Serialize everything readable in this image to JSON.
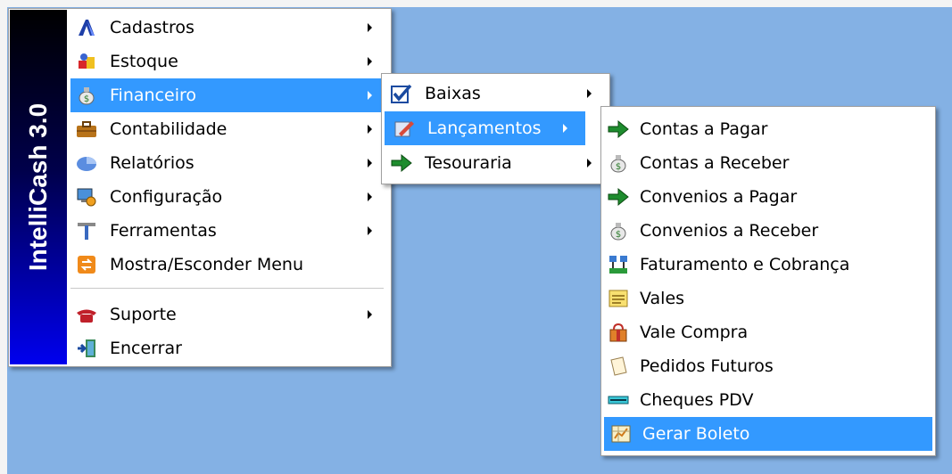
{
  "app": {
    "banner_text": "IntelliCash 3.0"
  },
  "main_menu": {
    "items": [
      {
        "label": "Cadastros",
        "icon": "cadastros-icon"
      },
      {
        "label": "Estoque",
        "icon": "estoque-icon"
      },
      {
        "label": "Financeiro",
        "icon": "money-bag-icon"
      },
      {
        "label": "Contabilidade",
        "icon": "briefcase-icon"
      },
      {
        "label": "Relatórios",
        "icon": "pie-chart-icon"
      },
      {
        "label": "Configuração",
        "icon": "configuration-icon"
      },
      {
        "label": "Ferramentas",
        "icon": "tools-icon"
      },
      {
        "label": "Mostra/Esconder Menu",
        "icon": "toggle-menu-icon"
      },
      {
        "label": "Suporte",
        "icon": "telephone-icon"
      },
      {
        "label": "Encerrar",
        "icon": "exit-door-icon"
      }
    ]
  },
  "financeiro_menu": {
    "items": [
      {
        "label": "Baixas",
        "icon": "checkbox-icon"
      },
      {
        "label": "Lançamentos",
        "icon": "edit-pen-icon"
      },
      {
        "label": "Tesouraria",
        "icon": "green-arrow-icon"
      }
    ]
  },
  "lancamentos_menu": {
    "items": [
      {
        "label": "Contas a Pagar",
        "icon": "green-arrow-icon"
      },
      {
        "label": "Contas a Receber",
        "icon": "money-bag-icon"
      },
      {
        "label": "Convenios a Pagar",
        "icon": "green-arrow-icon"
      },
      {
        "label": "Convenios a Receber",
        "icon": "money-bag-icon"
      },
      {
        "label": "Faturamento e Cobrança",
        "icon": "network-icon"
      },
      {
        "label": "Vales",
        "icon": "note-icon"
      },
      {
        "label": "Vale Compra",
        "icon": "gift-bag-icon"
      },
      {
        "label": "Pedidos Futuros",
        "icon": "document-icon"
      },
      {
        "label": "Cheques PDV",
        "icon": "cheque-icon"
      },
      {
        "label": "Gerar Boleto",
        "icon": "invoice-icon"
      }
    ]
  },
  "colors": {
    "desktop": "#84b1e4",
    "selection": "#3399ff",
    "banner_top": "#000000",
    "banner_bottom": "#0000ee"
  }
}
